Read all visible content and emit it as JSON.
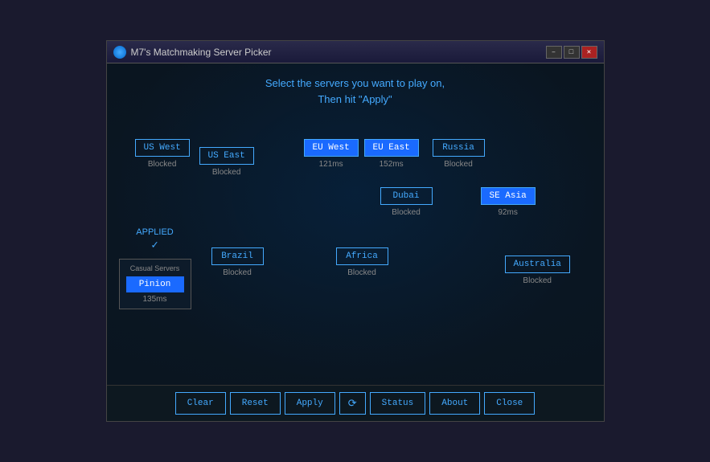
{
  "window": {
    "title": "M7's Matchmaking Server Picker",
    "icon": "globe-icon"
  },
  "titlebar_buttons": {
    "minimize": "–",
    "maximize": "□",
    "close": "✕"
  },
  "instruction": {
    "line1": "Select the servers you want to play on,",
    "line2": "Then hit \"Apply\""
  },
  "servers": {
    "us_west": {
      "label": "US West",
      "status": "Blocked",
      "active": false
    },
    "us_east": {
      "label": "US East",
      "status": "Blocked",
      "active": false
    },
    "eu_west": {
      "label": "EU West",
      "status": "121ms",
      "active": true
    },
    "eu_east": {
      "label": "EU East",
      "status": "152ms",
      "active": true
    },
    "russia": {
      "label": "Russia",
      "status": "Blocked",
      "active": false
    },
    "dubai": {
      "label": "Dubai",
      "status": "Blocked",
      "active": false
    },
    "se_asia": {
      "label": "SE Asia",
      "status": "92ms",
      "active": true
    },
    "brazil": {
      "label": "Brazil",
      "status": "Blocked",
      "active": false
    },
    "africa": {
      "label": "Africa",
      "status": "Blocked",
      "active": false
    },
    "australia": {
      "label": "Australia",
      "status": "Blocked",
      "active": false
    }
  },
  "applied": {
    "label": "APPLIED",
    "check": "✓"
  },
  "casual": {
    "label": "Casual Servers",
    "pinion_label": "Pinion",
    "pinion_ms": "135ms"
  },
  "buttons": {
    "clear": "Clear",
    "reset": "Reset",
    "apply": "Apply",
    "refresh": "⟳",
    "status": "Status",
    "about": "About",
    "close": "Close"
  }
}
